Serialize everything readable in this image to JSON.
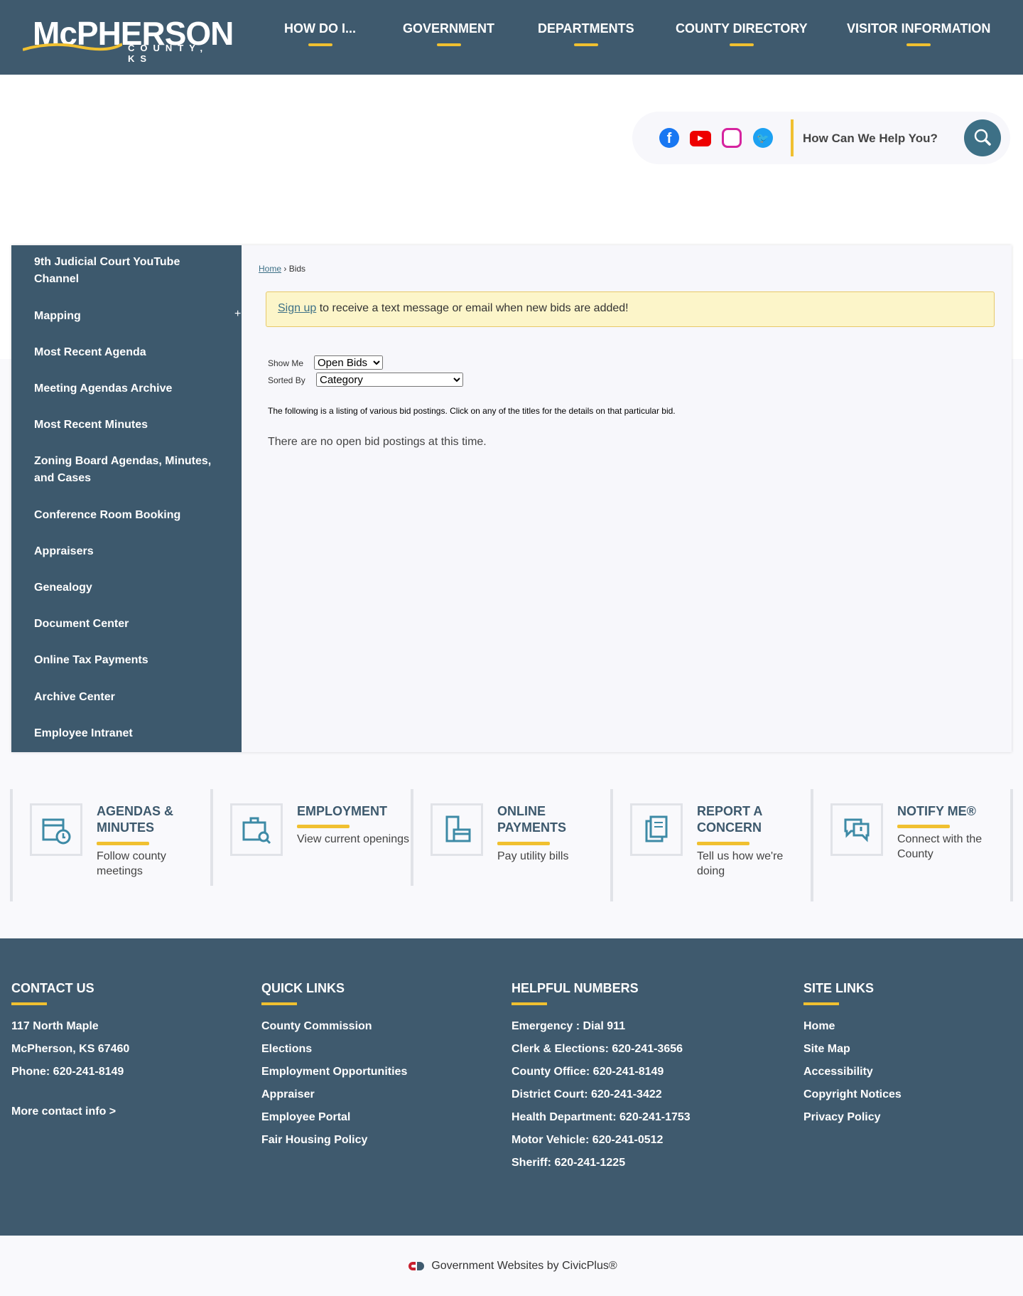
{
  "header": {
    "logo_main": "McPHERSON",
    "logo_sub": "COUNTY, KS",
    "nav": [
      "HOW DO I...",
      "GOVERNMENT",
      "DEPARTMENTS",
      "COUNTY DIRECTORY",
      "VISITOR INFORMATION"
    ]
  },
  "search": {
    "placeholder": "How Can We Help You?",
    "social": [
      "facebook-icon",
      "youtube-icon",
      "instagram-icon",
      "twitter-icon"
    ]
  },
  "sidebar": {
    "items": [
      "9th Judicial Court YouTube Channel",
      "Mapping",
      "Most Recent Agenda",
      "Meeting Agendas Archive",
      "Most Recent Minutes",
      "Zoning Board Agendas, Minutes, and Cases",
      "Conference Room Booking",
      "Appraisers",
      "Genealogy",
      "Document Center",
      "Online Tax Payments",
      "Archive Center",
      "Employee Intranet"
    ],
    "expand": "+"
  },
  "breadcrumb": {
    "home": "Home",
    "sep": "›",
    "current": "Bids"
  },
  "alert": {
    "link": "Sign up",
    "text": " to receive a text message or email when new bids are added!"
  },
  "filters": {
    "show_label": "Show Me",
    "show_value": "Open Bids",
    "sort_label": "Sorted By",
    "sort_value": "Category"
  },
  "content": {
    "info": "The following is a listing of various bid postings. Click on any of the titles for the details on that particular bid.",
    "empty": "There are no open bid postings at this time."
  },
  "tiles": [
    {
      "title": "AGENDAS & MINUTES",
      "desc": "Follow county meetings"
    },
    {
      "title": "EMPLOYMENT",
      "desc": "View current openings"
    },
    {
      "title": "ONLINE PAYMENTS",
      "desc": "Pay utility bills"
    },
    {
      "title": "REPORT A CONCERN",
      "desc": "Tell us how we're doing"
    },
    {
      "title": "NOTIFY ME®",
      "desc": "Connect with the County"
    }
  ],
  "footer": {
    "contact": {
      "title": "CONTACT US",
      "lines": [
        "117 North Maple",
        "McPherson, KS 67460",
        "Phone: 620-241-8149"
      ],
      "more": "More contact info >"
    },
    "quick": {
      "title": "QUICK LINKS",
      "items": [
        "County Commission",
        "Elections",
        "Employment Opportunities",
        "Appraiser",
        "Employee Portal",
        "Fair Housing Policy"
      ]
    },
    "numbers": {
      "title": "HELPFUL NUMBERS",
      "items": [
        "Emergency : Dial 911",
        "Clerk & Elections: 620-241-3656",
        "County Office: 620-241-8149",
        "District Court: 620-241-3422",
        "Health Department: 620-241-1753",
        "Motor Vehicle: 620-241-0512",
        "Sheriff: 620-241-1225"
      ]
    },
    "site": {
      "title": "SITE LINKS",
      "items": [
        "Home",
        "Site Map",
        "Accessibility",
        "Copyright Notices",
        "Privacy Policy"
      ]
    }
  },
  "credit": "Government Websites by CivicPlus®",
  "colors": {
    "header": "#3f5a6e",
    "accent": "#f0c030",
    "link": "#3d7086"
  }
}
